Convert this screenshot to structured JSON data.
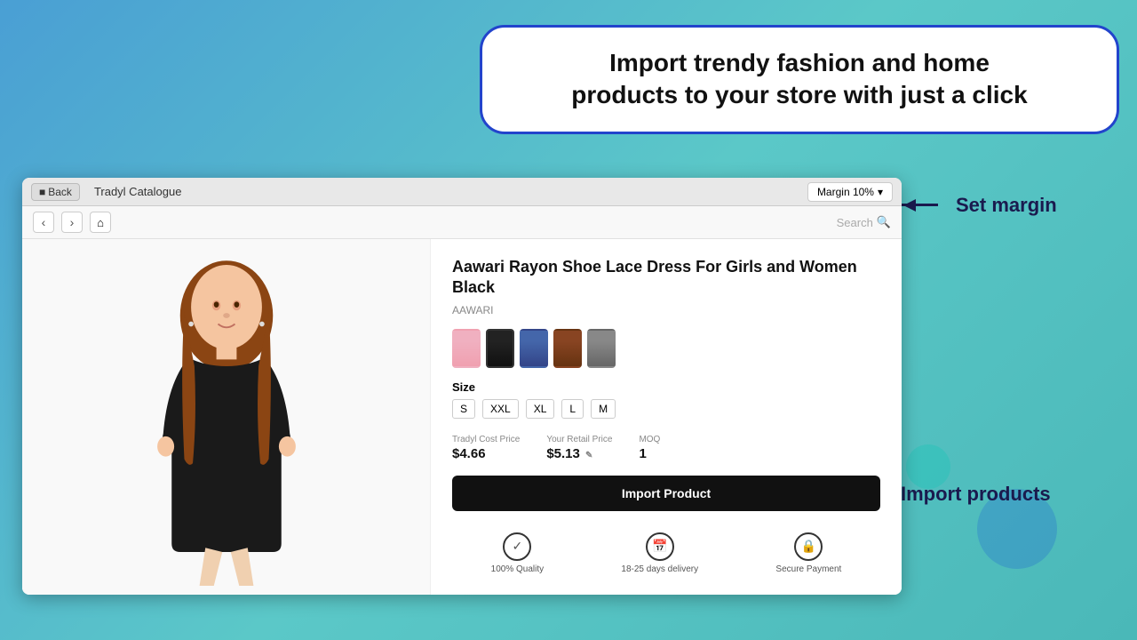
{
  "hero": {
    "callout_line1": "Import trendy fashion and home",
    "callout_line2": "products to your store with just a click"
  },
  "browser": {
    "back_label": "Back",
    "title": "Tradyl Catalogue",
    "margin_btn": "Margin 10%"
  },
  "toolbar": {
    "search_placeholder": "Search"
  },
  "product": {
    "title": "Aawari Rayon Shoe Lace Dress For Girls and Women Black",
    "brand": "AAWARI",
    "sizes": [
      "S",
      "XXL",
      "XL",
      "L",
      "M"
    ],
    "cost_price_label": "Tradyl Cost Price",
    "cost_price": "$4.66",
    "retail_price_label": "Your Retail Price",
    "retail_price": "$5.13",
    "moq_label": "MOQ",
    "moq": "1",
    "import_btn": "Import Product"
  },
  "badges": [
    {
      "icon": "✓",
      "label": "100% Quality"
    },
    {
      "icon": "🗓",
      "label": "18-25 days delivery"
    },
    {
      "icon": "🔒",
      "label": "Secure Payment"
    }
  ],
  "annotations": {
    "set_margin": "Set margin",
    "import_products": "Import products"
  },
  "colors": {
    "brand_dark": "#1a1a4e",
    "import_btn_bg": "#111111",
    "border_accent": "#2244cc"
  }
}
